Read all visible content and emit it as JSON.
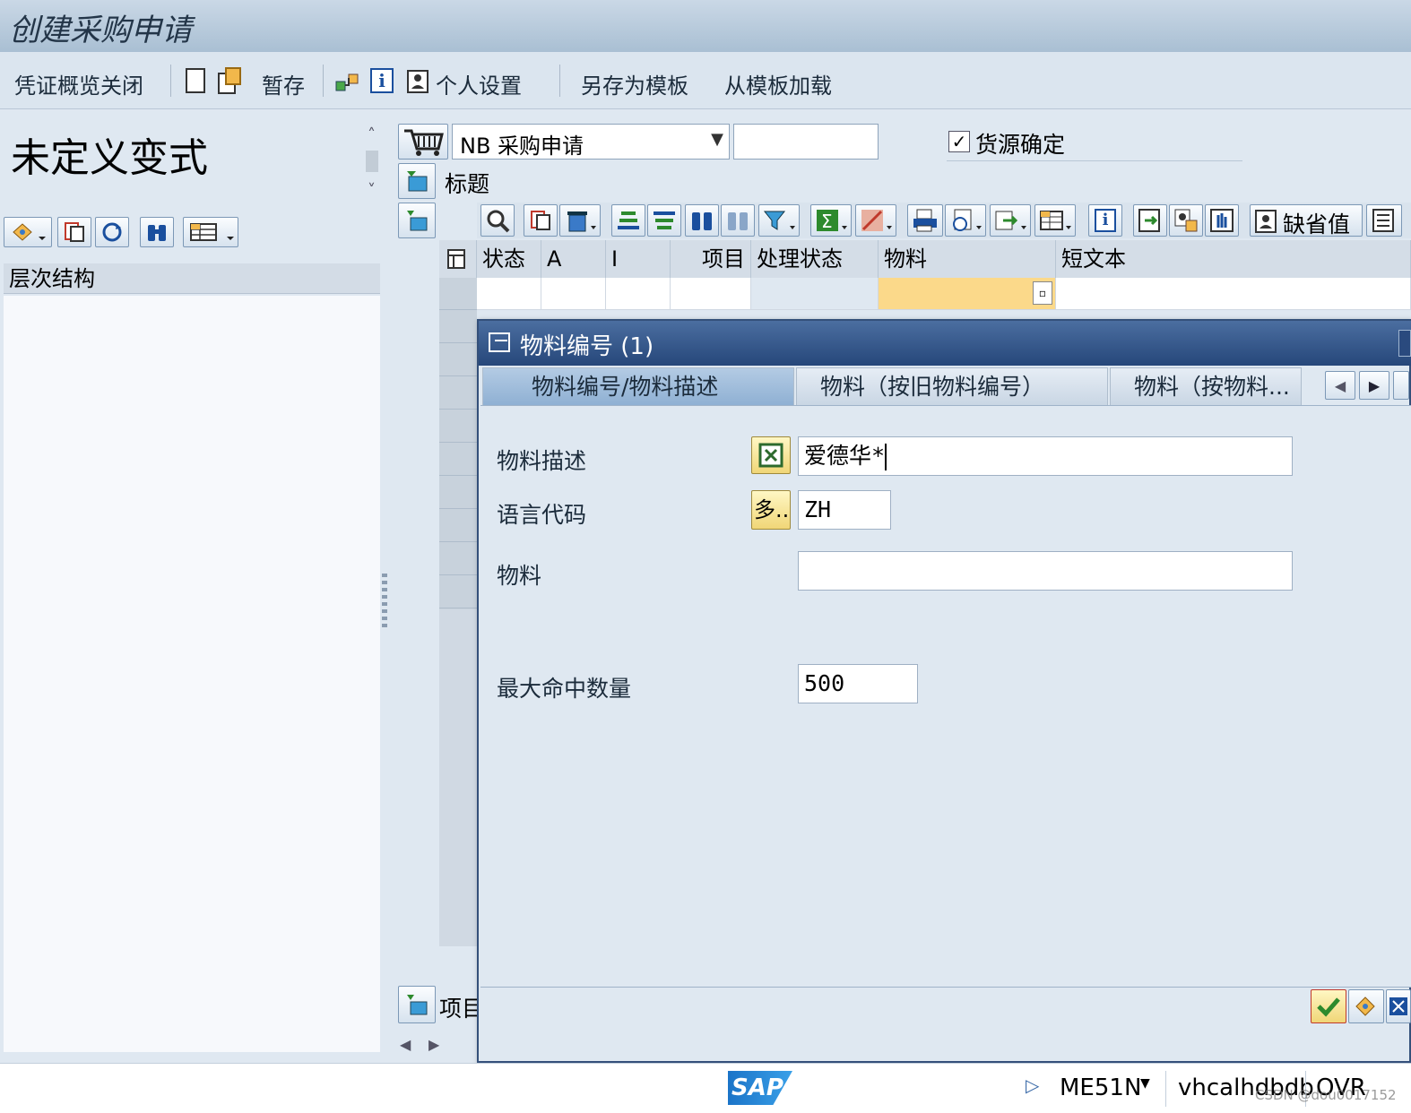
{
  "app": {
    "title": "创建采购申请"
  },
  "toolbar": {
    "close_overview": "凭证概览关闭",
    "hold": "暂存",
    "personal_settings": "个人设置",
    "save_as_template": "另存为模板",
    "load_from_template": "从模板加载"
  },
  "left": {
    "variant_title": "未定义变式",
    "tree_header": "层次结构"
  },
  "header": {
    "doc_type": "NB 采购申请",
    "doc_number": "",
    "source_determination": "货源确定",
    "source_determination_checked": true,
    "title_label": "标题",
    "default_values": "缺省值",
    "item_section_label": "项目"
  },
  "grid": {
    "columns": [
      "状态",
      "A",
      "I",
      "项目",
      "处理状态",
      "物料",
      "短文本"
    ]
  },
  "dialog": {
    "title": "物料编号 (1)",
    "tabs": [
      "物料编号/物料描述",
      "物料（按旧物料编号）",
      "物料（按物料..."
    ],
    "fields": {
      "material_desc_label": "物料描述",
      "material_desc_value": "爱德华*",
      "language_label": "语言代码",
      "language_multi": "多...",
      "language_value": "ZH",
      "material_label": "物料",
      "material_value": "",
      "max_hits_label": "最大命中数量",
      "max_hits_value": "500"
    }
  },
  "status": {
    "logo": "SAP",
    "tcode": "ME51N",
    "server": "vhcalhdbdb",
    "mode": "OVR",
    "watermark": "CSDN @dou0017152"
  }
}
